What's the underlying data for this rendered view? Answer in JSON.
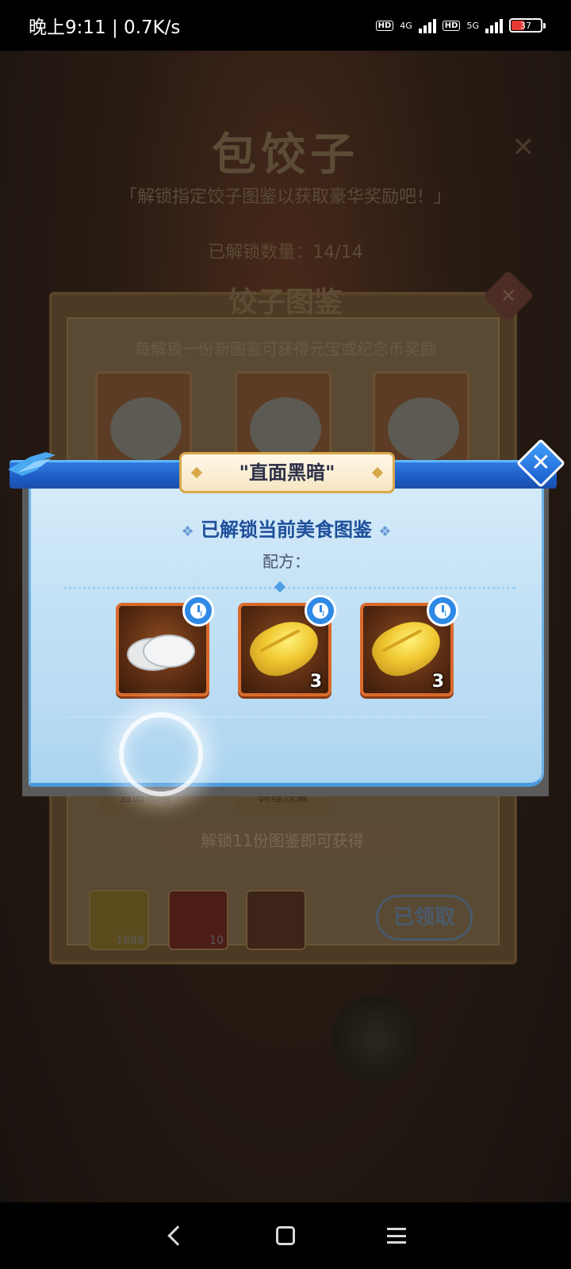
{
  "status_bar": {
    "time_speed": "晚上9:11 | 0.7K/s",
    "network_1": "4G",
    "network_2": "5G",
    "hd_label": "HD",
    "battery": "37"
  },
  "background": {
    "title": "包饺子",
    "subtitle": "「解锁指定饺子图鉴以获取豪华奖励吧！」",
    "unlocked_count": "已解锁数量：14/14",
    "book_title": "饺子图鉴",
    "book_desc": "每解锁一份新图鉴可获得元宝或纪念币奖励",
    "labels": [
      "\"直面黑暗\"",
      "\"调理饺翼\""
    ],
    "reward_title": "解锁11份图鉴即可获得",
    "rewards": [
      {
        "icon": "gold-ingot-icon",
        "qty": "1888"
      },
      {
        "icon": "banner-token-icon",
        "qty": "10"
      },
      {
        "icon": "chest-icon",
        "qty": ""
      }
    ],
    "claimed_button": "已领取"
  },
  "modal": {
    "header_title": "\"直面黑暗\"",
    "close_icon": "close-icon",
    "title": "已解锁当前美食图鉴",
    "recipe_label": "配方：",
    "ingredients": [
      {
        "name": "dumpling-wrapper",
        "icon": "dumpling-wrapper-icon",
        "qty": "",
        "timer_icon": "clock-icon"
      },
      {
        "name": "napa-cabbage",
        "icon": "cabbage-icon",
        "qty": "3",
        "timer_icon": "clock-icon"
      },
      {
        "name": "napa-cabbage",
        "icon": "cabbage-icon",
        "qty": "3",
        "timer_icon": "clock-icon"
      }
    ]
  },
  "nav_bar": {
    "back_icon": "back-icon",
    "home_icon": "home-icon",
    "menu_icon": "menu-icon"
  },
  "colors": {
    "modal_header": "#1d5cc4",
    "modal_body": "#c4e2f6",
    "ingredient_border": "#d96a2c",
    "title_text": "#1f4f9a"
  }
}
